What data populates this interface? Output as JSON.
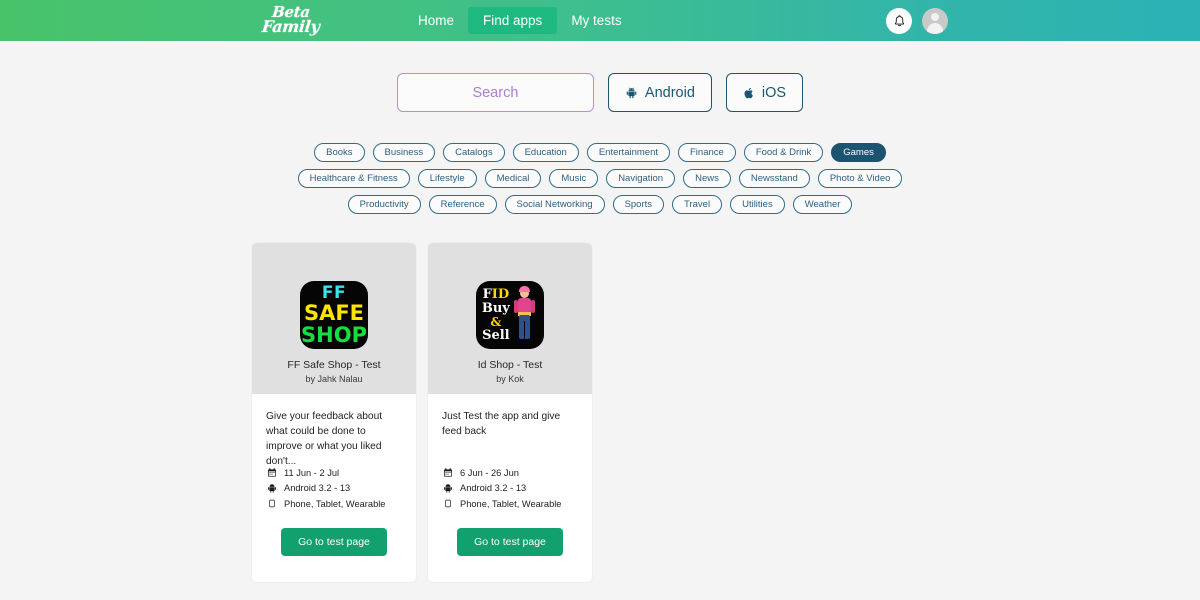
{
  "header": {
    "logo_line1": "Beta",
    "logo_line2": "Family",
    "logo_name": "beta-family-logo",
    "nav": [
      {
        "label": "Home",
        "active": false
      },
      {
        "label": "Find apps",
        "active": true
      },
      {
        "label": "My tests",
        "active": false
      }
    ],
    "notification_icon": "bell-icon",
    "avatar_icon": "user-avatar",
    "gradient_start": "#49c36a",
    "gradient_end": "#2bb2b5",
    "active_pill_color": "#1db981"
  },
  "search": {
    "placeholder": "Search",
    "value": "",
    "border_color": "#b38fd4",
    "text_color": "#a87fd0",
    "platforms": [
      {
        "label": "Android",
        "icon": "android-icon"
      },
      {
        "label": "iOS",
        "icon": "apple-icon"
      }
    ],
    "platform_color": "#1d5570"
  },
  "categories": {
    "selected_color": "#1b5370",
    "border_color": "#2e6b8c",
    "items": [
      {
        "label": "Books",
        "selected": false
      },
      {
        "label": "Business",
        "selected": false
      },
      {
        "label": "Catalogs",
        "selected": false
      },
      {
        "label": "Education",
        "selected": false
      },
      {
        "label": "Entertainment",
        "selected": false
      },
      {
        "label": "Finance",
        "selected": false
      },
      {
        "label": "Food & Drink",
        "selected": false
      },
      {
        "label": "Games",
        "selected": true
      },
      {
        "label": "Healthcare & Fitness",
        "selected": false
      },
      {
        "label": "Lifestyle",
        "selected": false
      },
      {
        "label": "Medical",
        "selected": false
      },
      {
        "label": "Music",
        "selected": false
      },
      {
        "label": "Navigation",
        "selected": false
      },
      {
        "label": "News",
        "selected": false
      },
      {
        "label": "Newsstand",
        "selected": false
      },
      {
        "label": "Photo & Video",
        "selected": false
      },
      {
        "label": "Productivity",
        "selected": false
      },
      {
        "label": "Reference",
        "selected": false
      },
      {
        "label": "Social Networking",
        "selected": false
      },
      {
        "label": "Sports",
        "selected": false
      },
      {
        "label": "Travel",
        "selected": false
      },
      {
        "label": "Utilities",
        "selected": false
      },
      {
        "label": "Weather",
        "selected": false
      }
    ]
  },
  "cards": [
    {
      "icon_style": "ff-safe-shop",
      "icon_text": {
        "line1": "FF",
        "line2": "SAFE",
        "line3": "SHOP"
      },
      "icon_colors": {
        "line1": "#3fe0ef",
        "line2": "#ffe400",
        "line3": "#13e03f",
        "bg": "#050505"
      },
      "title": "FF Safe Shop - Test",
      "author": "by Jahk Nalau",
      "description": "Give your feedback about what could be done to improve or what you liked don't...",
      "meta": [
        {
          "icon": "calendar-icon",
          "text": "11 Jun - 2 Jul"
        },
        {
          "icon": "android-icon",
          "text": "Android 3.2 - 13"
        },
        {
          "icon": "device-icon",
          "text": "Phone, Tablet, Wearable"
        }
      ],
      "button_label": "Go to test page"
    },
    {
      "icon_style": "id-shop",
      "icon_text": {
        "t1a": "F",
        "t1b": "ID",
        "t2": "Buy",
        "t3": "&",
        "t4": "Sell"
      },
      "icon_colors": {
        "white": "#ffffff",
        "yellow": "#ffd400",
        "bg": "#050505"
      },
      "title": "Id Shop - Test",
      "author": "by Kok",
      "description": "Just Test the app and give feed back",
      "meta": [
        {
          "icon": "calendar-icon",
          "text": "6 Jun - 26 Jun"
        },
        {
          "icon": "android-icon",
          "text": "Android 3.2 - 13"
        },
        {
          "icon": "device-icon",
          "text": "Phone, Tablet, Wearable"
        }
      ],
      "button_label": "Go to test page"
    }
  ],
  "theme": {
    "page_background": "#f4f4f4",
    "card_top_background": "#e0e0e0",
    "button_color": "#12a06e"
  }
}
